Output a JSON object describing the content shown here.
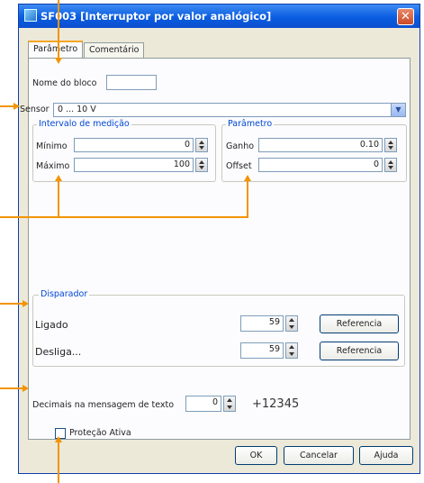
{
  "window": {
    "title": "SF003 [Interruptor por valor analógico]",
    "close_label": "✕"
  },
  "tabs": [
    {
      "label": "Parâmetro",
      "active": true
    },
    {
      "label": "Comentário",
      "active": false
    }
  ],
  "block_name": {
    "label": "Nome do bloco",
    "value": ""
  },
  "sensor": {
    "label": "Sensor",
    "value": "0 ... 10 V"
  },
  "measurement_interval": {
    "title": "Intervalo de medição",
    "min_label": "Mínimo",
    "min_value": "0",
    "max_label": "Máximo",
    "max_value": "100"
  },
  "parameter_group": {
    "title": "Parâmetro",
    "gain_label": "Ganho",
    "gain_value": "0.10",
    "offset_label": "Offset",
    "offset_value": "0"
  },
  "trigger": {
    "title": "Disparador",
    "on_label": "Ligado",
    "on_value": "59",
    "off_label": "Desliga...",
    "off_value": "59",
    "reference_label": "Referencia"
  },
  "decimals": {
    "label": "Decimais na mensagem de texto",
    "value": "0",
    "preview": "+12345"
  },
  "protection": {
    "label": "Proteção Ativa",
    "checked": false
  },
  "footer": {
    "ok_label": "OK",
    "cancel_label": "Cancelar",
    "help_label": "Ajuda"
  },
  "colors": {
    "accent_callout": "#f29400",
    "title_bar": "#0a5ce0",
    "group_title": "#0046d5"
  }
}
